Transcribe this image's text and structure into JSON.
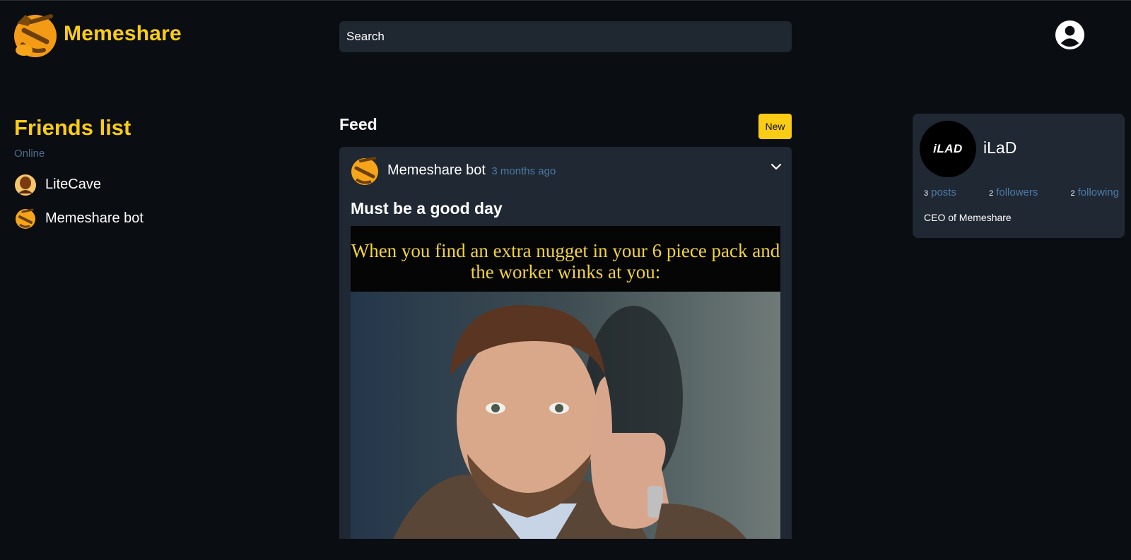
{
  "header": {
    "app_name": "Memeshare",
    "logo_icon": "thinking-face-emoji",
    "search_placeholder": "Search",
    "account_icon": "user-circle-icon"
  },
  "friends": {
    "title": "Friends list",
    "status_label": "Online",
    "items": [
      {
        "name": "LiteCave",
        "avatar": "avatar-litecave"
      },
      {
        "name": "Memeshare bot",
        "avatar": "thinking-face-emoji"
      }
    ]
  },
  "feed": {
    "title": "Feed",
    "new_button": "New",
    "posts": [
      {
        "author": "Memeshare bot",
        "time": "3 months ago",
        "title": "Must be a good day",
        "meme_caption": "When you find an extra nugget in your 6 piece pack and the worker winks at you:"
      }
    ]
  },
  "profile": {
    "username": "iLaD",
    "avatar_text": "iLAD",
    "stats": [
      {
        "count": "3",
        "label": "posts"
      },
      {
        "count": "2",
        "label": "followers"
      },
      {
        "count": "2",
        "label": "following"
      }
    ],
    "bio": "CEO of Memeshare"
  },
  "colors": {
    "background": "#0a0d11",
    "card": "#202833",
    "accent": "#facc15",
    "muted_link": "#4d7aa8"
  }
}
